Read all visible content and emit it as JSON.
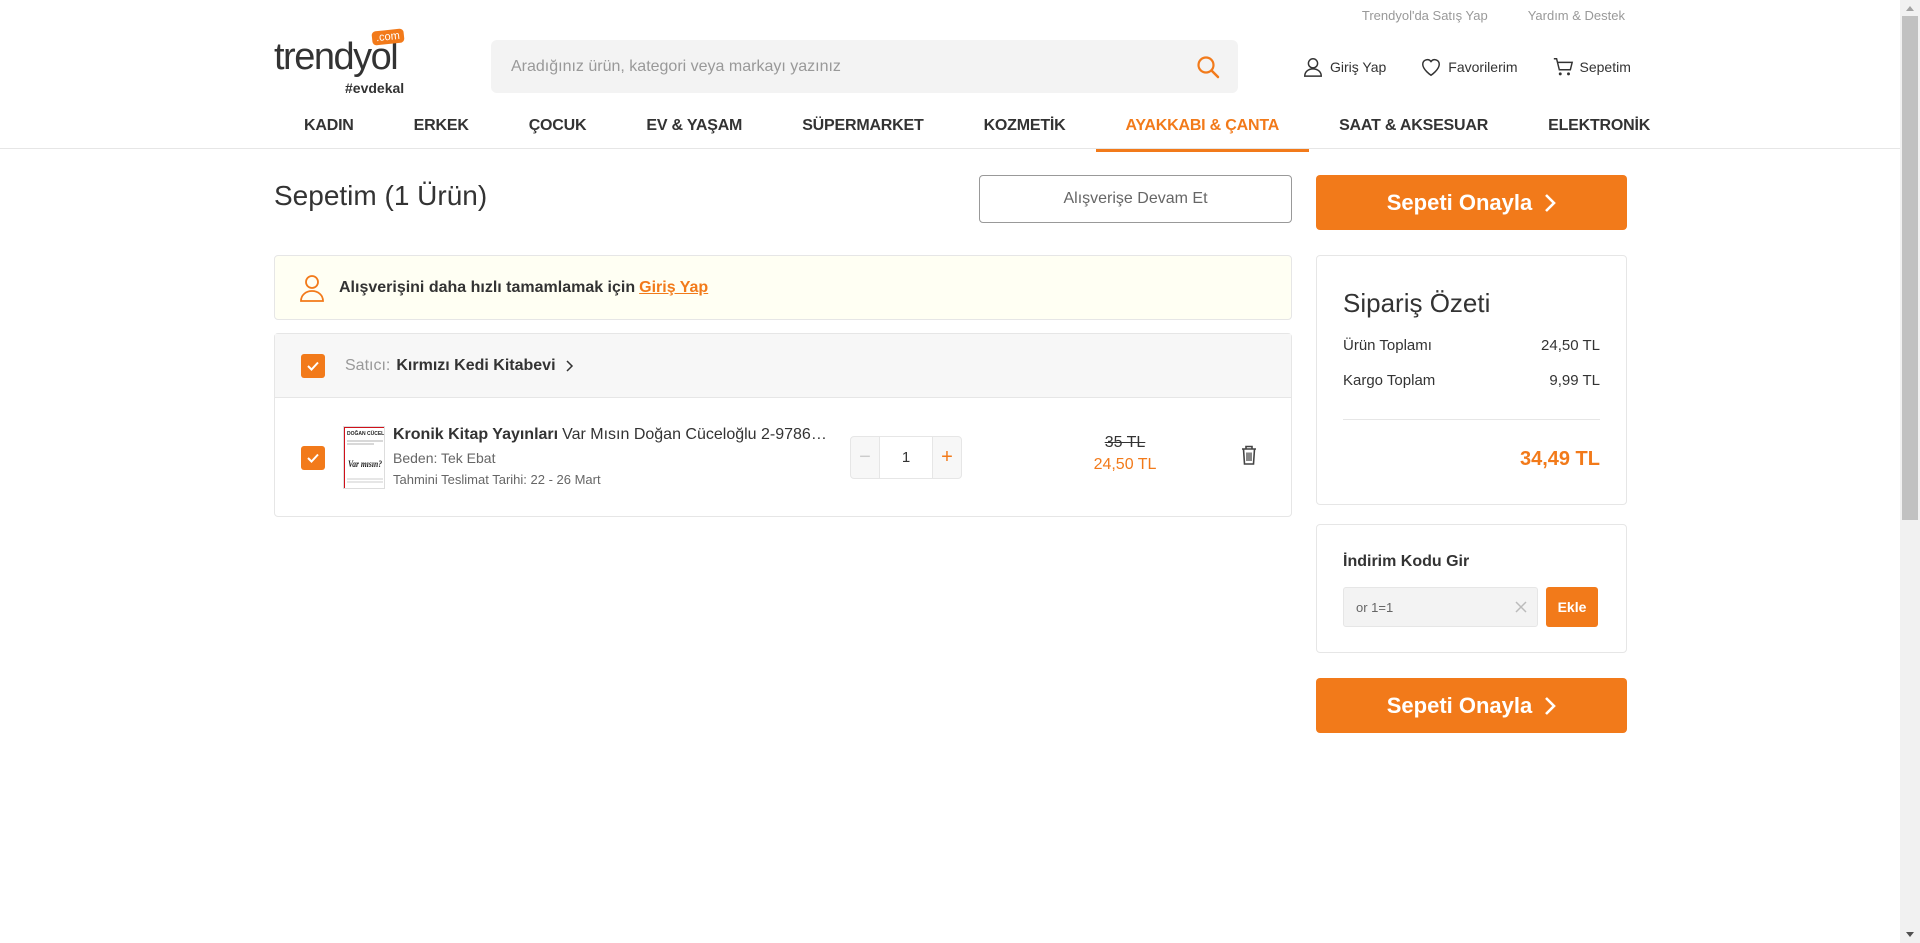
{
  "header": {
    "top_links": [
      "Trendyol'da Satış Yap",
      "Yardım & Destek"
    ],
    "logo": {
      "word": "trendyol",
      "com": ".com",
      "tag": "#evdekal"
    },
    "search_placeholder": "Aradığınız ürün, kategori veya markayı yazınız",
    "actions": {
      "login": "Giriş Yap",
      "favorites": "Favorilerim",
      "cart": "Sepetim"
    },
    "nav": [
      "KADIN",
      "ERKEK",
      "ÇOCUK",
      "EV & YAŞAM",
      "SÜPERMARKET",
      "KOZMETİK",
      "AYAKKABI & ÇANTA",
      "SAAT & AKSESUAR",
      "ELEKTRONİK"
    ],
    "nav_active_index": 6
  },
  "cart": {
    "title": "Sepetim (1 Ürün)",
    "continue_label": "Alışverişe Devam Et",
    "login_banner": {
      "text": "Alışverişini daha hızlı tamamlamak için",
      "link": "Giriş Yap"
    },
    "seller": {
      "label": "Satıcı:",
      "name": "Kırmızı Kedi Kitabevi"
    },
    "item": {
      "brand": "Kronik Kitap Yayınları",
      "name": "Var Mısın Doğan Cüceloğlu 2-9786…",
      "size": "Beden: Tek Ebat",
      "delivery": "Tahmini Teslimat Tarihi: 22 - 26 Mart",
      "quantity": "1",
      "old_price": "35 TL",
      "new_price": "24,50 TL",
      "thumb_text": {
        "author": "DOĞAN CÜCELOĞLU",
        "title": "Var mısın?"
      }
    }
  },
  "summary": {
    "confirm_label": "Sepeti Onayla",
    "title": "Sipariş Özeti",
    "rows": [
      {
        "label": "Ürün Toplamı",
        "value": "24,50 TL"
      },
      {
        "label": "Kargo Toplam",
        "value": "9,99 TL"
      }
    ],
    "total": "34,49 TL"
  },
  "coupon": {
    "title": "İndirim Kodu Gir",
    "value": "or 1=1",
    "button": "Ekle"
  },
  "colors": {
    "accent": "#f27a1a",
    "text": "#333333",
    "muted": "#999999",
    "banner_bg": "#fffff3"
  }
}
